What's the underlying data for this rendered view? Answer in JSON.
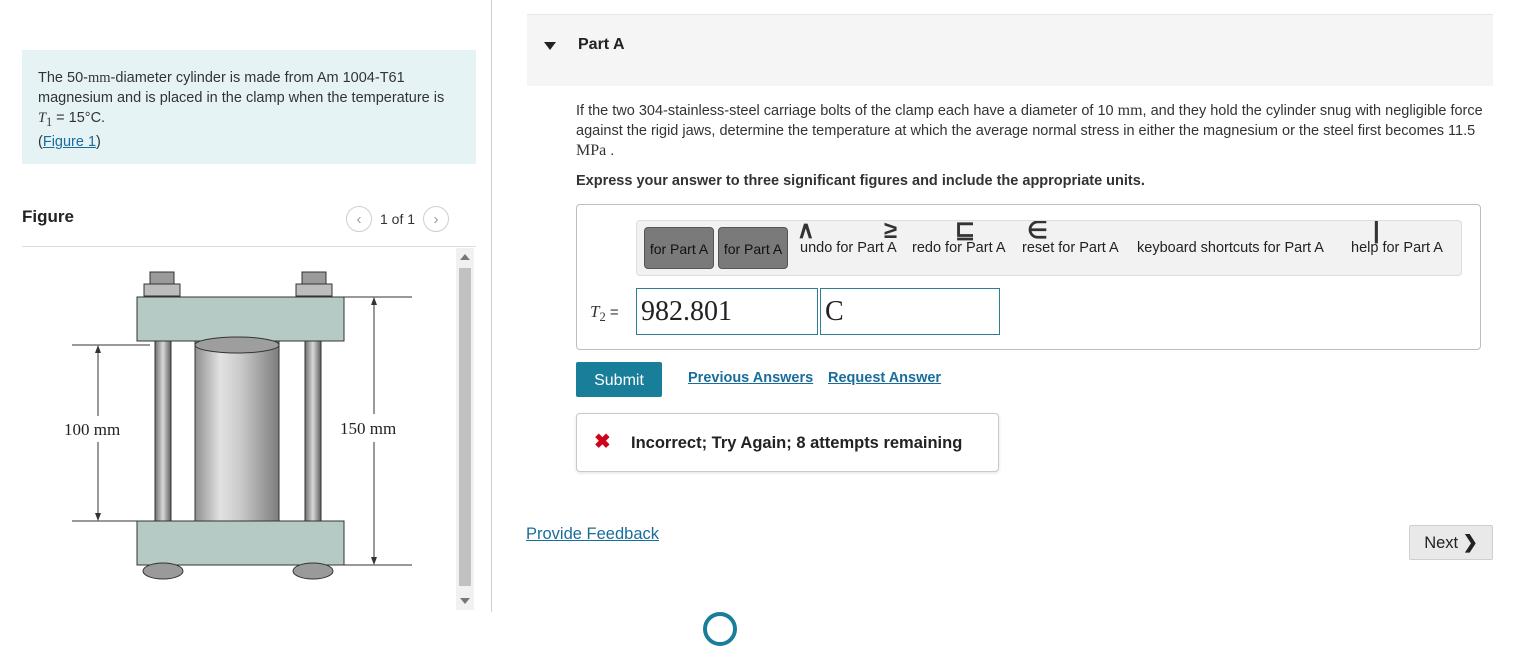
{
  "problem": {
    "text_before_mm": "The 50-",
    "unit_mm": "mm",
    "text_mid": "-diameter cylinder is made from Am 1004-T61 magnesium and is placed in the clamp when the temperature is ",
    "temp_symbol": "T",
    "temp_sub": "1",
    "temp_value": " = 15°C.",
    "figure_link": "Figure 1"
  },
  "figure": {
    "title": "Figure",
    "counter": "1 of 1",
    "dim_left": "100 mm",
    "dim_right": "150 mm",
    "prev_icon": "chevron-left-icon",
    "next_icon": "chevron-right-icon"
  },
  "part": {
    "title": "Part A",
    "question_1": "If the two 304-stainless-steel carriage bolts of the clamp each have a diameter of 10 ",
    "question_unit": "mm",
    "question_2": ", and they hold the cylinder snug with negligible force against the rigid jaws, determine the temperature at which the average normal stress in either the magnesium or the steel first becomes 11.5 ",
    "question_unit2": "MPa",
    "question_end": " .",
    "instruction": "Express your answer to three significant figures and include the appropriate units."
  },
  "toolbar": {
    "btn1": "for Part A",
    "btn2": "for Part A",
    "undo": "undo for Part A",
    "redo": "redo for Part A",
    "reset": "reset for Part A",
    "keyboard": "keyboard shortcuts for Part A",
    "help": "help for Part A"
  },
  "answer": {
    "var_symbol": "T",
    "var_sub": "2",
    "equals": " =",
    "value": "982.801",
    "unit": "C"
  },
  "actions": {
    "submit": "Submit",
    "previous_answers": "Previous Answers",
    "request_answer": "Request Answer"
  },
  "feedback": {
    "icon": "close-icon",
    "text": "Incorrect; Try Again; 8 attempts remaining"
  },
  "footer": {
    "provide_feedback": "Provide Feedback",
    "next": "Next"
  },
  "colors": {
    "accent": "#187e99",
    "link": "#1a6d9b",
    "problem_bg": "#e6f3f5",
    "error": "#d0021b"
  }
}
